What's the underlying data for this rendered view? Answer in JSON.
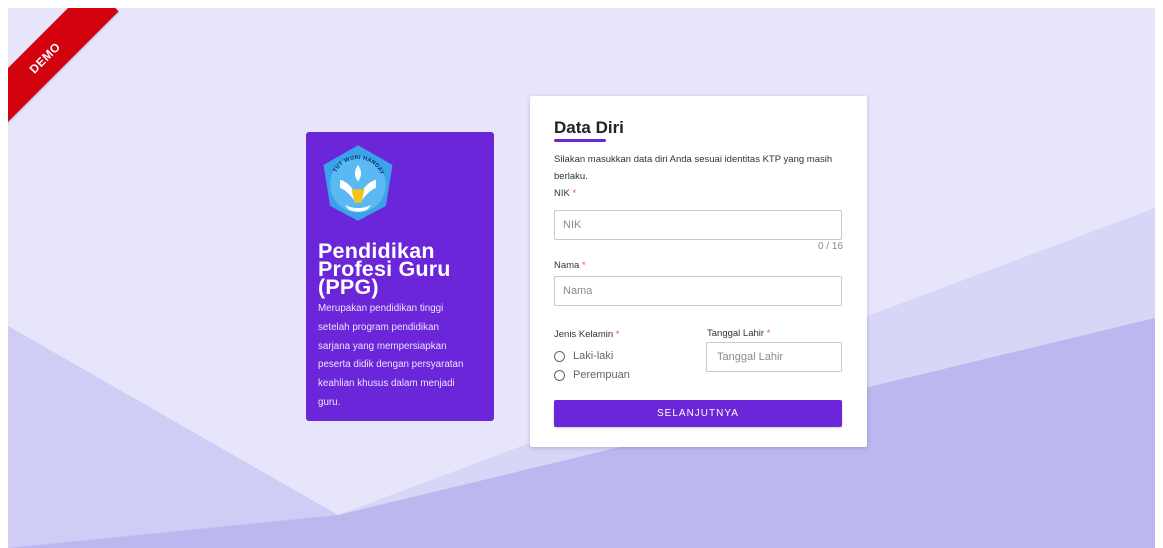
{
  "ribbon": {
    "label": "DEMO",
    "color": "#d2020f"
  },
  "colors": {
    "accent": "#6b26d9",
    "background": "#e6e5fb",
    "shape_light": "#d7d6f7",
    "shape_mid": "#c6c4f3",
    "shape_dark": "#b7b4ef",
    "required": "#ef5350"
  },
  "info_card": {
    "logo": "tut-wuri-handayani-logo",
    "logo_text": "TUT WURI HANDAYANI",
    "title_lines": [
      "Pendidikan",
      "Profesi Guru",
      "(PPG)"
    ],
    "description_lines": [
      "Merupakan pendidikan tinggi",
      "setelah program pendidikan",
      "sarjana yang mempersiapkan",
      "peserta didik dengan persyaratan",
      "keahlian khusus dalam menjadi",
      "guru."
    ]
  },
  "form": {
    "title": "Data Diri",
    "description": "Silakan masukkan data diri Anda sesuai identitas KTP yang masih berlaku.",
    "nik": {
      "label": "NIK",
      "required_mark": "*",
      "placeholder": "NIK",
      "value": "",
      "counter": "0 / 16"
    },
    "nama": {
      "label": "Nama",
      "required_mark": "*",
      "placeholder": "Nama",
      "value": ""
    },
    "gender": {
      "label": "Jenis Kelamin",
      "required_mark": "*",
      "options": [
        "Laki-laki",
        "Perempuan"
      ]
    },
    "birthdate": {
      "label": "Tanggal Lahir",
      "required_mark": "*",
      "placeholder": "Tanggal Lahir",
      "value": ""
    },
    "submit_label": "SELANJUTNYA"
  }
}
